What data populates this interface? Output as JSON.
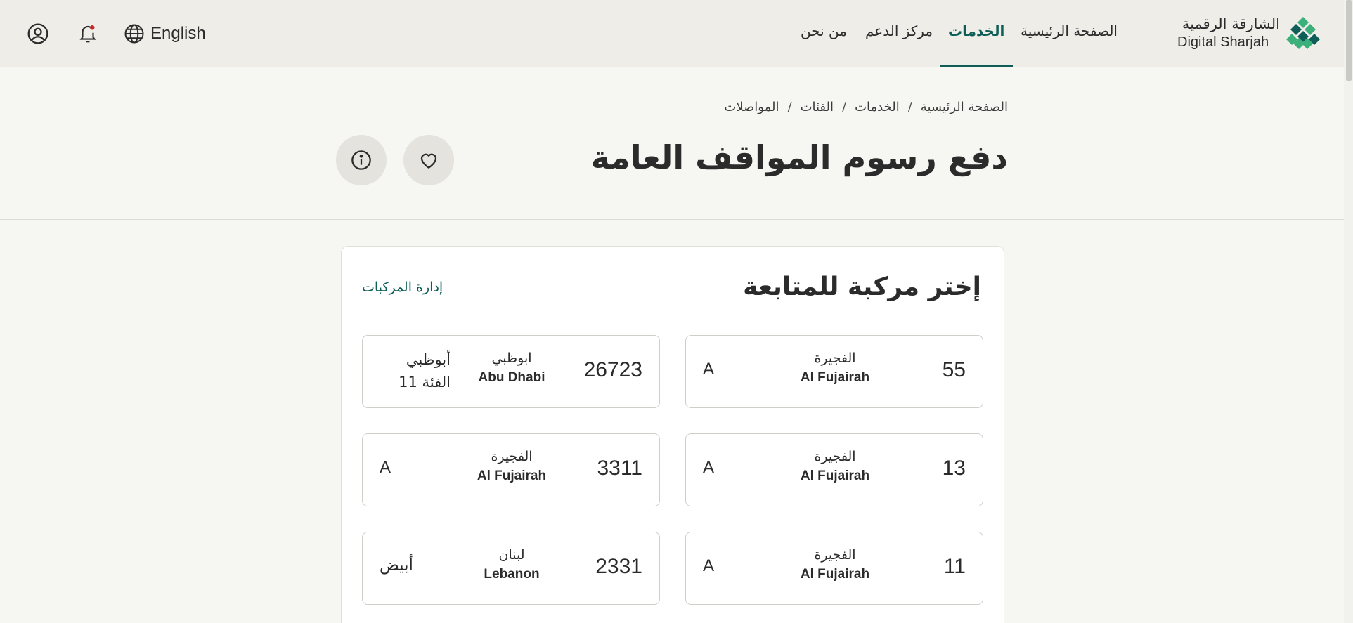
{
  "header": {
    "logo": {
      "ar": "الشارقة الرقمية",
      "en": "Digital Sharjah"
    },
    "nav": [
      {
        "label": "الصفحة الرئيسية",
        "active": false
      },
      {
        "label": "الخدمات",
        "active": true
      },
      {
        "label": "مركز الدعم",
        "active": false
      },
      {
        "label": "من نحن",
        "active": false
      }
    ],
    "language": "English",
    "icons": {
      "language": "globe-icon",
      "notifications": "bell-icon",
      "profile": "user-circle-icon"
    },
    "accent_color": "#0e5e57"
  },
  "breadcrumb": [
    "الصفحة الرئيسية",
    "الخدمات",
    "الفئات",
    "المواصلات"
  ],
  "breadcrumb_separator": "/",
  "page_title": "دفع رسوم المواقف العامة",
  "actions": {
    "favorite": "heart-icon",
    "info": "info-icon"
  },
  "vehicles_section": {
    "title": "إختر مركبة للمتابعة",
    "manage_link": "إدارة المركبات",
    "vehicles": [
      {
        "number": "55",
        "emirate_ar": "الفجيرة",
        "emirate_en": "Al Fujairah",
        "code": "A"
      },
      {
        "number": "26723",
        "emirate_ar": "ابوظبي",
        "emirate_en": "Abu Dhabi",
        "code_line1": "أبوظبي",
        "code_line2": "الفئة 11"
      },
      {
        "number": "13",
        "emirate_ar": "الفجيرة",
        "emirate_en": "Al Fujairah",
        "code": "A"
      },
      {
        "number": "3311",
        "emirate_ar": "الفجيرة",
        "emirate_en": "Al Fujairah",
        "code": "A"
      },
      {
        "number": "11",
        "emirate_ar": "الفجيرة",
        "emirate_en": "Al Fujairah",
        "code": "A"
      },
      {
        "number": "2331",
        "emirate_ar": "لبنان",
        "emirate_en": "Lebanon",
        "code": "أبيض"
      }
    ]
  }
}
